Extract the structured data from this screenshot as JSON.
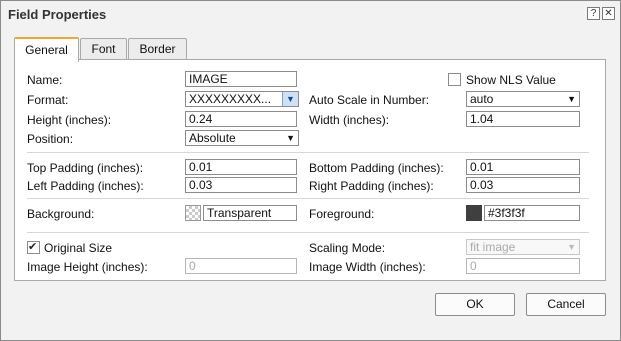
{
  "dialog": {
    "title": "Field Properties",
    "help_icon": "help-icon",
    "close_icon": "close-icon"
  },
  "tabs": [
    {
      "label": "General",
      "active": true
    },
    {
      "label": "Font",
      "active": false
    },
    {
      "label": "Border",
      "active": false
    }
  ],
  "general": {
    "name_label": "Name:",
    "name_value": "IMAGE",
    "show_nls_label": "Show NLS Value",
    "show_nls_checked": false,
    "format_label": "Format:",
    "format_value": "XXXXXXXXX...",
    "auto_scale_label": "Auto Scale in Number:",
    "auto_scale_value": "auto",
    "height_label": "Height (inches):",
    "height_value": "0.24",
    "width_label": "Width (inches):",
    "width_value": "1.04",
    "position_label": "Position:",
    "position_value": "Absolute",
    "top_padding_label": "Top Padding (inches):",
    "top_padding_value": "0.01",
    "bottom_padding_label": "Bottom Padding (inches):",
    "bottom_padding_value": "0.01",
    "left_padding_label": "Left Padding (inches):",
    "left_padding_value": "0.03",
    "right_padding_label": "Right Padding (inches):",
    "right_padding_value": "0.03",
    "background_label": "Background:",
    "background_value": "Transparent",
    "foreground_label": "Foreground:",
    "foreground_value": "#3f3f3f",
    "foreground_color": "#3f3f3f",
    "original_size_label": "Original Size",
    "original_size_checked": true,
    "scaling_mode_label": "Scaling Mode:",
    "scaling_mode_value": "fit image",
    "image_height_label": "Image Height (inches):",
    "image_height_value": "0",
    "image_width_label": "Image Width (inches):",
    "image_width_value": "0"
  },
  "buttons": {
    "ok_label": "OK",
    "cancel_label": "Cancel"
  }
}
